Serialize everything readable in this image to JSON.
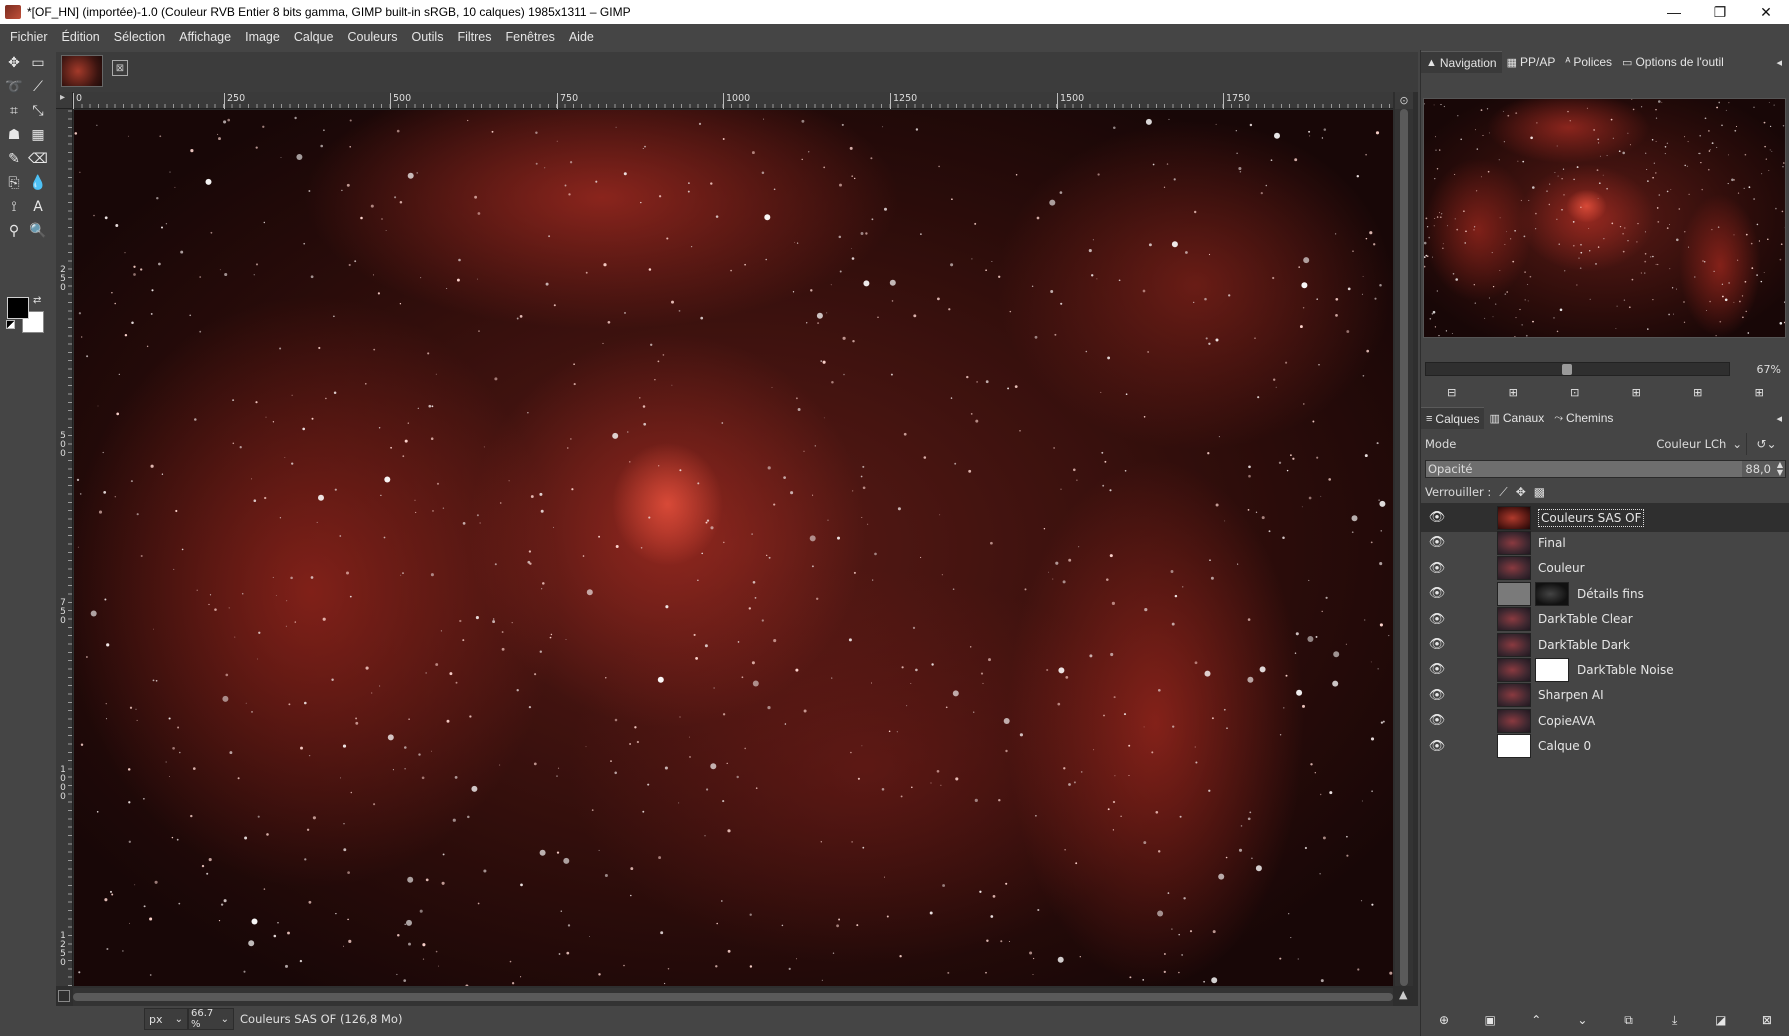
{
  "window": {
    "title": "*[OF_HN] (importée)-1.0 (Couleur RVB Entier 8 bits gamma, GIMP built-in sRGB, 10 calques) 1985x1311 – GIMP",
    "minimize": "—",
    "maximize": "❐",
    "close": "✕"
  },
  "menu": [
    "Fichier",
    "Édition",
    "Sélection",
    "Affichage",
    "Image",
    "Calque",
    "Couleurs",
    "Outils",
    "Filtres",
    "Fenêtres",
    "Aide"
  ],
  "rulers": {
    "h_ticks": [
      "0",
      "250",
      "500",
      "750",
      "1000",
      "1250",
      "1500",
      "1750"
    ],
    "v_ticks": [
      "250",
      "500",
      "750",
      "1000",
      "1250"
    ]
  },
  "status": {
    "unit": "px",
    "zoom": "66.7 %",
    "text": "Couleurs SAS OF (126,8 Mo)"
  },
  "dock_top_tabs": [
    {
      "icon": "▲",
      "label": "Navigation"
    },
    {
      "icon": "▦",
      "label": "PP/AP"
    },
    {
      "icon": "ᴬ",
      "label": "Polices"
    },
    {
      "icon": "▭",
      "label": "Options de l'outil"
    }
  ],
  "navigation": {
    "zoom_label": "67%",
    "zoom_fraction": 0.46
  },
  "dock_layer_tabs": [
    {
      "icon": "≡",
      "label": "Calques"
    },
    {
      "icon": "▥",
      "label": "Canaux"
    },
    {
      "icon": "⤳",
      "label": "Chemins"
    }
  ],
  "layers_panel": {
    "mode_label": "Mode",
    "mode_value": "Couleur LCh",
    "opacity_label": "Opacité",
    "opacity_value": "88,0",
    "opacity_fraction": 0.88,
    "lock_label": "Verrouiller :"
  },
  "layers": [
    {
      "name": "Couleurs SAS OF",
      "selected": true,
      "thumb": "reddish",
      "mask": null
    },
    {
      "name": "Final",
      "selected": false,
      "thumb": "img",
      "mask": null
    },
    {
      "name": "Couleur",
      "selected": false,
      "thumb": "img",
      "mask": null
    },
    {
      "name": "Détails fins",
      "selected": false,
      "thumb": "grey",
      "mask": "dark"
    },
    {
      "name": "DarkTable Clear",
      "selected": false,
      "thumb": "img",
      "mask": null
    },
    {
      "name": "DarkTable Dark",
      "selected": false,
      "thumb": "img",
      "mask": null
    },
    {
      "name": "DarkTable Noise",
      "selected": false,
      "thumb": "img",
      "mask": "white"
    },
    {
      "name": "Sharpen AI",
      "selected": false,
      "thumb": "img",
      "mask": null
    },
    {
      "name": "CopieAVA",
      "selected": false,
      "thumb": "img",
      "mask": null
    },
    {
      "name": "Calque 0",
      "selected": false,
      "thumb": "white",
      "mask": null
    }
  ],
  "colors": {
    "ui_bg": "#454545",
    "canvas_bg": "#2e2e2e",
    "nebula_red": "#a83828",
    "selected_row": "#2f2f2f"
  }
}
